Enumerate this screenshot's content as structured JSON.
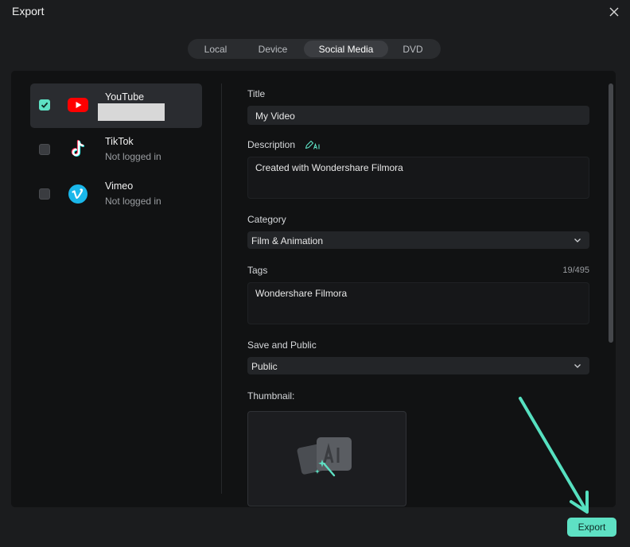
{
  "window": {
    "title": "Export"
  },
  "tabs": [
    {
      "label": "Local",
      "active": false
    },
    {
      "label": "Device",
      "active": false
    },
    {
      "label": "Social Media",
      "active": true
    },
    {
      "label": "DVD",
      "active": false
    }
  ],
  "platforms": [
    {
      "name": "YouTube",
      "status": "",
      "checked": true,
      "selected": true,
      "icon": "youtube-icon"
    },
    {
      "name": "TikTok",
      "status": "Not logged in",
      "checked": false,
      "selected": false,
      "icon": "tiktok-icon"
    },
    {
      "name": "Vimeo",
      "status": "Not logged in",
      "checked": false,
      "selected": false,
      "icon": "vimeo-icon"
    }
  ],
  "form": {
    "title_label": "Title",
    "title_value": "My Video",
    "description_label": "Description",
    "description_value": "Created with Wondershare Filmora",
    "category_label": "Category",
    "category_value": "Film & Animation",
    "tags_label": "Tags",
    "tags_counter": "19/495",
    "tags_value": "Wondershare Filmora",
    "privacy_label": "Save and Public",
    "privacy_value": "Public",
    "thumbnail_label": "Thumbnail:"
  },
  "footer": {
    "export_label": "Export"
  },
  "colors": {
    "accent": "#5ee1c4",
    "background": "#1b1c1e",
    "panel": "#111213",
    "youtube_red": "#ff0000",
    "vimeo_blue": "#1ab7ea"
  }
}
